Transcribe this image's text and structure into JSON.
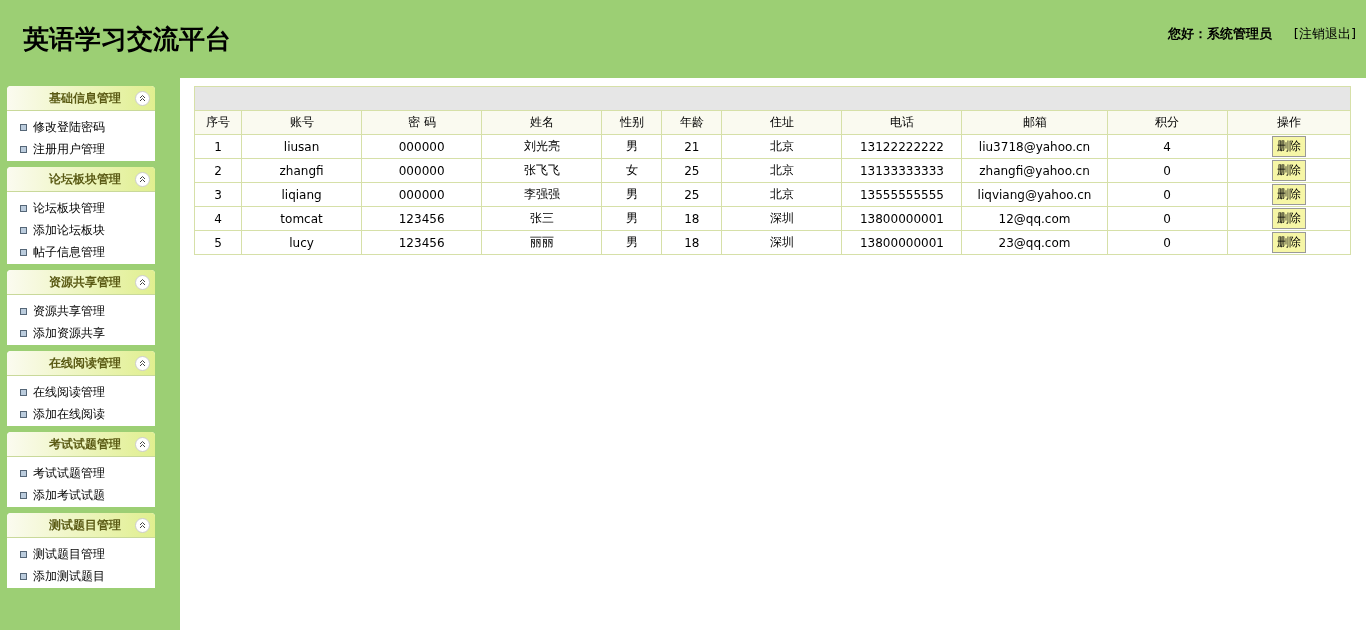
{
  "header": {
    "title": "英语学习交流平台",
    "greeting": "您好：系统管理员",
    "logout": "[注销退出]"
  },
  "sidebar": [
    {
      "title": "基础信息管理",
      "items": [
        "修改登陆密码",
        "注册用户管理"
      ]
    },
    {
      "title": "论坛板块管理",
      "items": [
        "论坛板块管理",
        "添加论坛板块",
        "帖子信息管理"
      ]
    },
    {
      "title": "资源共享管理",
      "items": [
        "资源共享管理",
        "添加资源共享"
      ]
    },
    {
      "title": "在线阅读管理",
      "items": [
        "在线阅读管理",
        "添加在线阅读"
      ]
    },
    {
      "title": "考试试题管理",
      "items": [
        "考试试题管理",
        "添加考试试题"
      ]
    },
    {
      "title": "测试题目管理",
      "items": [
        "测试题目管理",
        "添加测试题目"
      ]
    }
  ],
  "table": {
    "columns": [
      "序号",
      "账号",
      "密 码",
      "姓名",
      "性别",
      "年龄",
      "住址",
      "电话",
      "邮箱",
      "积分",
      "操作"
    ],
    "rows": [
      {
        "cells": [
          "1",
          "liusan",
          "000000",
          "刘光亮",
          "男",
          "21",
          "北京",
          "13122222222",
          "liu3718@yahoo.cn",
          "4"
        ],
        "action": "删除"
      },
      {
        "cells": [
          "2",
          "zhangfi",
          "000000",
          "张飞飞",
          "女",
          "25",
          "北京",
          "13133333333",
          "zhangfi@yahoo.cn",
          "0"
        ],
        "action": "删除"
      },
      {
        "cells": [
          "3",
          "liqiang",
          "000000",
          "李强强",
          "男",
          "25",
          "北京",
          "13555555555",
          "liqviang@yahoo.cn",
          "0"
        ],
        "action": "删除"
      },
      {
        "cells": [
          "4",
          "tomcat",
          "123456",
          "张三",
          "男",
          "18",
          "深圳",
          "13800000001",
          "12@qq.com",
          "0"
        ],
        "action": "删除"
      },
      {
        "cells": [
          "5",
          "lucy",
          "123456",
          "丽丽",
          "男",
          "18",
          "深圳",
          "13800000001",
          "23@qq.com",
          "0"
        ],
        "action": "删除"
      }
    ]
  }
}
